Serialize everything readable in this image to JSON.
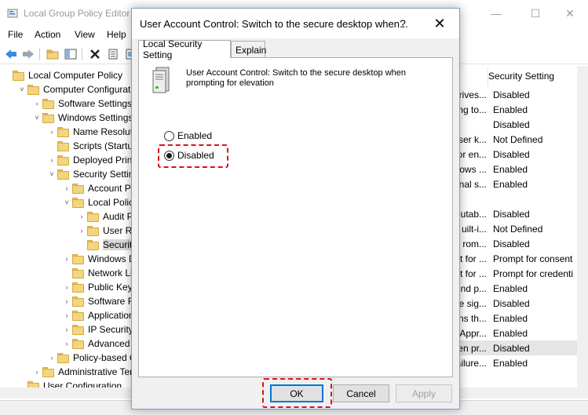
{
  "main_window": {
    "title": "Local Group Policy Editor",
    "menu": [
      "File",
      "Action",
      "View",
      "Help"
    ],
    "tree": [
      {
        "label": "Local Computer Policy",
        "indent": 0,
        "arrow": ""
      },
      {
        "label": "Computer Configuration",
        "indent": 1,
        "arrow": "˅"
      },
      {
        "label": "Software Settings",
        "indent": 2,
        "arrow": "›"
      },
      {
        "label": "Windows Settings",
        "indent": 2,
        "arrow": "˅"
      },
      {
        "label": "Name Resolution",
        "indent": 3,
        "arrow": "›"
      },
      {
        "label": "Scripts (Startup/",
        "indent": 3,
        "arrow": ""
      },
      {
        "label": "Deployed Printers",
        "indent": 3,
        "arrow": "›"
      },
      {
        "label": "Security Settings",
        "indent": 3,
        "arrow": "˅"
      },
      {
        "label": "Account Policies",
        "indent": 4,
        "arrow": "›"
      },
      {
        "label": "Local Policies",
        "indent": 4,
        "arrow": "˅"
      },
      {
        "label": "Audit Policy",
        "indent": 5,
        "arrow": "›"
      },
      {
        "label": "User Rights",
        "indent": 5,
        "arrow": "›"
      },
      {
        "label": "Security Options",
        "indent": 5,
        "arrow": "",
        "selected": true
      },
      {
        "label": "Windows Defender",
        "indent": 4,
        "arrow": "›"
      },
      {
        "label": "Network List",
        "indent": 4,
        "arrow": ""
      },
      {
        "label": "Public Key Policies",
        "indent": 4,
        "arrow": "›"
      },
      {
        "label": "Software Restriction",
        "indent": 4,
        "arrow": "›"
      },
      {
        "label": "Application Control",
        "indent": 4,
        "arrow": "›"
      },
      {
        "label": "IP Security Policies",
        "indent": 4,
        "arrow": "›"
      },
      {
        "label": "Advanced Audit",
        "indent": 4,
        "arrow": "›"
      },
      {
        "label": "Policy-based QoS",
        "indent": 3,
        "arrow": "›"
      },
      {
        "label": "Administrative Templates",
        "indent": 2,
        "arrow": "›"
      },
      {
        "label": "User Configuration",
        "indent": 1,
        "arrow": ""
      }
    ],
    "column_header": "Security Setting",
    "policies": [
      {
        "name": "drives...",
        "value": "Disabled"
      },
      {
        "name": "ring to...",
        "value": "Enabled"
      },
      {
        "name": "",
        "value": "Disabled"
      },
      {
        "name": "ser k...",
        "value": "Not Defined"
      },
      {
        "name": "for en...",
        "value": "Disabled"
      },
      {
        "name": "ows ...",
        "value": "Enabled"
      },
      {
        "name": "nal s...",
        "value": "Enabled"
      },
      {
        "name": "",
        "value": ""
      },
      {
        "name": "utab...",
        "value": "Disabled"
      },
      {
        "name": "uilt-i...",
        "value": "Not Defined"
      },
      {
        "name": "rom...",
        "value": "Disabled"
      },
      {
        "name": "rt for ...",
        "value": "Prompt for consent"
      },
      {
        "name": "pt for ...",
        "value": "Prompt for credenti"
      },
      {
        "name": "nd p...",
        "value": "Enabled"
      },
      {
        "name": "e sig...",
        "value": "Disabled"
      },
      {
        "name": "ns th...",
        "value": "Enabled"
      },
      {
        "name": "Appr...",
        "value": "Enabled"
      },
      {
        "name": "en pr...",
        "value": "Disabled",
        "highlight": true
      },
      {
        "name": "ailure...",
        "value": "Enabled"
      }
    ]
  },
  "dialog": {
    "title": "User Account Control: Switch to the secure desktop when...",
    "help_glyph": "?",
    "close_glyph": "✕",
    "tabs": [
      "Local Security Setting",
      "Explain"
    ],
    "active_tab": "Local Security Setting",
    "policy_description": "User Account Control: Switch to the secure desktop when prompting for elevation",
    "options": [
      {
        "label": "Enabled",
        "checked": false
      },
      {
        "label": "Disabled",
        "checked": true
      }
    ],
    "buttons": {
      "ok": "OK",
      "cancel": "Cancel",
      "apply": "Apply"
    },
    "highlight_color": "#d8101c"
  }
}
